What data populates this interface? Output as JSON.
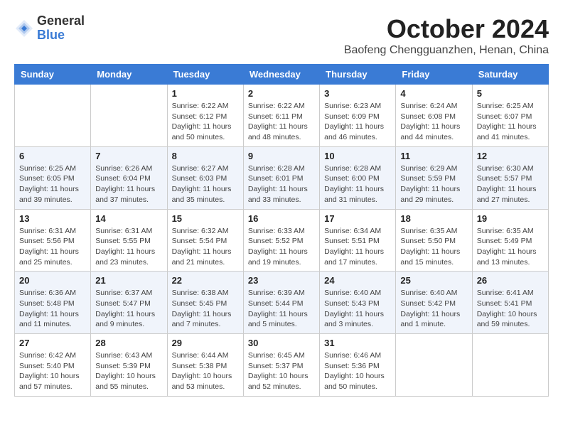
{
  "header": {
    "logo_general": "General",
    "logo_blue": "Blue",
    "month_title": "October 2024",
    "location": "Baofeng Chengguanzhen, Henan, China"
  },
  "weekdays": [
    "Sunday",
    "Monday",
    "Tuesday",
    "Wednesday",
    "Thursday",
    "Friday",
    "Saturday"
  ],
  "weeks": [
    [
      {
        "day": "",
        "detail": ""
      },
      {
        "day": "",
        "detail": ""
      },
      {
        "day": "1",
        "detail": "Sunrise: 6:22 AM\nSunset: 6:12 PM\nDaylight: 11 hours and 50 minutes."
      },
      {
        "day": "2",
        "detail": "Sunrise: 6:22 AM\nSunset: 6:11 PM\nDaylight: 11 hours and 48 minutes."
      },
      {
        "day": "3",
        "detail": "Sunrise: 6:23 AM\nSunset: 6:09 PM\nDaylight: 11 hours and 46 minutes."
      },
      {
        "day": "4",
        "detail": "Sunrise: 6:24 AM\nSunset: 6:08 PM\nDaylight: 11 hours and 44 minutes."
      },
      {
        "day": "5",
        "detail": "Sunrise: 6:25 AM\nSunset: 6:07 PM\nDaylight: 11 hours and 41 minutes."
      }
    ],
    [
      {
        "day": "6",
        "detail": "Sunrise: 6:25 AM\nSunset: 6:05 PM\nDaylight: 11 hours and 39 minutes."
      },
      {
        "day": "7",
        "detail": "Sunrise: 6:26 AM\nSunset: 6:04 PM\nDaylight: 11 hours and 37 minutes."
      },
      {
        "day": "8",
        "detail": "Sunrise: 6:27 AM\nSunset: 6:03 PM\nDaylight: 11 hours and 35 minutes."
      },
      {
        "day": "9",
        "detail": "Sunrise: 6:28 AM\nSunset: 6:01 PM\nDaylight: 11 hours and 33 minutes."
      },
      {
        "day": "10",
        "detail": "Sunrise: 6:28 AM\nSunset: 6:00 PM\nDaylight: 11 hours and 31 minutes."
      },
      {
        "day": "11",
        "detail": "Sunrise: 6:29 AM\nSunset: 5:59 PM\nDaylight: 11 hours and 29 minutes."
      },
      {
        "day": "12",
        "detail": "Sunrise: 6:30 AM\nSunset: 5:57 PM\nDaylight: 11 hours and 27 minutes."
      }
    ],
    [
      {
        "day": "13",
        "detail": "Sunrise: 6:31 AM\nSunset: 5:56 PM\nDaylight: 11 hours and 25 minutes."
      },
      {
        "day": "14",
        "detail": "Sunrise: 6:31 AM\nSunset: 5:55 PM\nDaylight: 11 hours and 23 minutes."
      },
      {
        "day": "15",
        "detail": "Sunrise: 6:32 AM\nSunset: 5:54 PM\nDaylight: 11 hours and 21 minutes."
      },
      {
        "day": "16",
        "detail": "Sunrise: 6:33 AM\nSunset: 5:52 PM\nDaylight: 11 hours and 19 minutes."
      },
      {
        "day": "17",
        "detail": "Sunrise: 6:34 AM\nSunset: 5:51 PM\nDaylight: 11 hours and 17 minutes."
      },
      {
        "day": "18",
        "detail": "Sunrise: 6:35 AM\nSunset: 5:50 PM\nDaylight: 11 hours and 15 minutes."
      },
      {
        "day": "19",
        "detail": "Sunrise: 6:35 AM\nSunset: 5:49 PM\nDaylight: 11 hours and 13 minutes."
      }
    ],
    [
      {
        "day": "20",
        "detail": "Sunrise: 6:36 AM\nSunset: 5:48 PM\nDaylight: 11 hours and 11 minutes."
      },
      {
        "day": "21",
        "detail": "Sunrise: 6:37 AM\nSunset: 5:47 PM\nDaylight: 11 hours and 9 minutes."
      },
      {
        "day": "22",
        "detail": "Sunrise: 6:38 AM\nSunset: 5:45 PM\nDaylight: 11 hours and 7 minutes."
      },
      {
        "day": "23",
        "detail": "Sunrise: 6:39 AM\nSunset: 5:44 PM\nDaylight: 11 hours and 5 minutes."
      },
      {
        "day": "24",
        "detail": "Sunrise: 6:40 AM\nSunset: 5:43 PM\nDaylight: 11 hours and 3 minutes."
      },
      {
        "day": "25",
        "detail": "Sunrise: 6:40 AM\nSunset: 5:42 PM\nDaylight: 11 hours and 1 minute."
      },
      {
        "day": "26",
        "detail": "Sunrise: 6:41 AM\nSunset: 5:41 PM\nDaylight: 10 hours and 59 minutes."
      }
    ],
    [
      {
        "day": "27",
        "detail": "Sunrise: 6:42 AM\nSunset: 5:40 PM\nDaylight: 10 hours and 57 minutes."
      },
      {
        "day": "28",
        "detail": "Sunrise: 6:43 AM\nSunset: 5:39 PM\nDaylight: 10 hours and 55 minutes."
      },
      {
        "day": "29",
        "detail": "Sunrise: 6:44 AM\nSunset: 5:38 PM\nDaylight: 10 hours and 53 minutes."
      },
      {
        "day": "30",
        "detail": "Sunrise: 6:45 AM\nSunset: 5:37 PM\nDaylight: 10 hours and 52 minutes."
      },
      {
        "day": "31",
        "detail": "Sunrise: 6:46 AM\nSunset: 5:36 PM\nDaylight: 10 hours and 50 minutes."
      },
      {
        "day": "",
        "detail": ""
      },
      {
        "day": "",
        "detail": ""
      }
    ]
  ]
}
